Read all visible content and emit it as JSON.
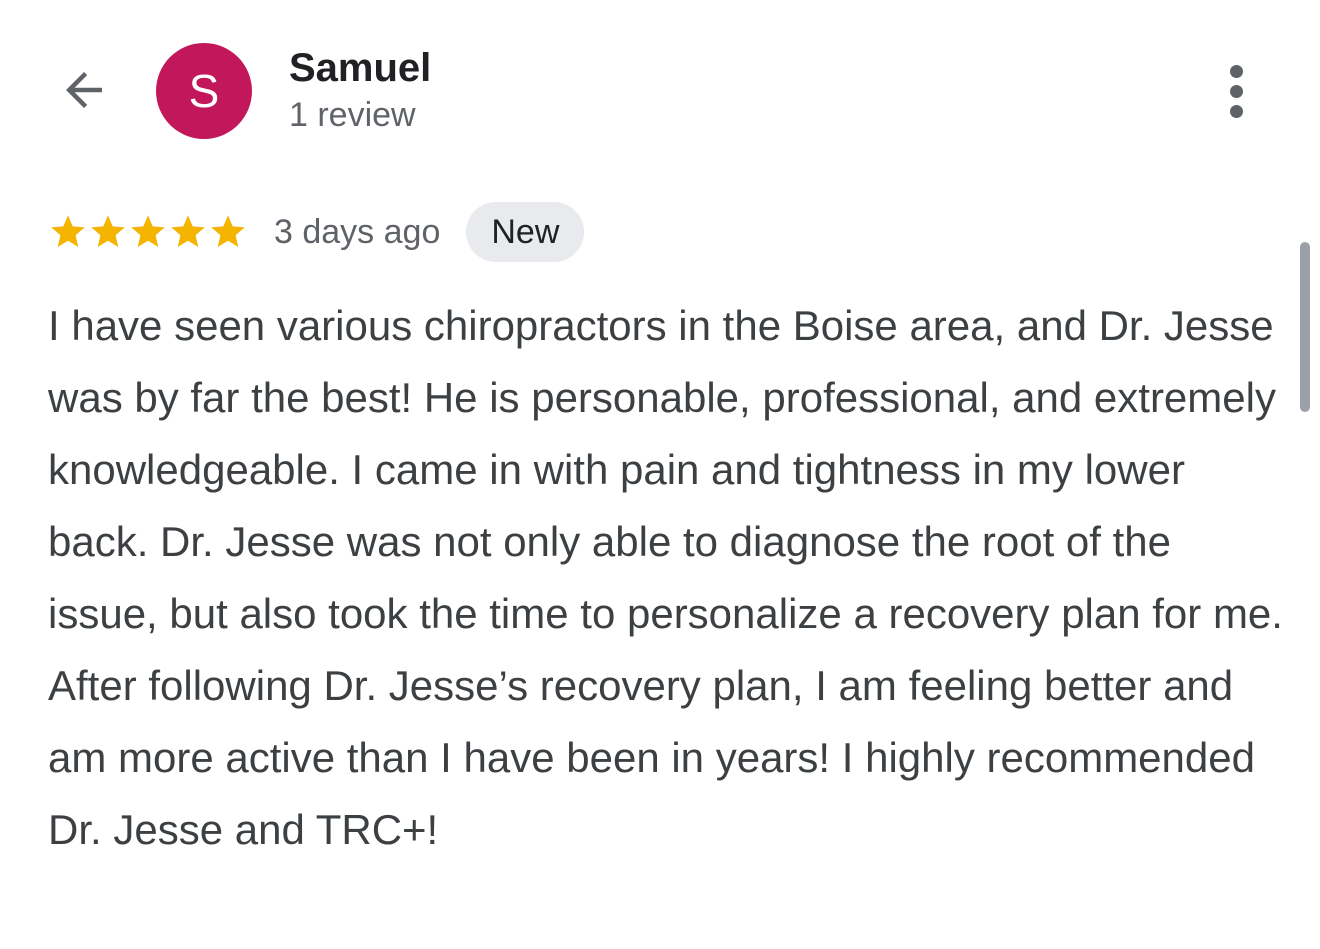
{
  "header": {
    "back_icon": "arrow-left-icon",
    "avatar_letter": "S",
    "avatar_color": "#c2185b",
    "reviewer_name": "Samuel",
    "review_count": "1 review",
    "more_icon": "more-vert-icon"
  },
  "review": {
    "rating": 5,
    "rating_max": 5,
    "star_color": "#f4b400",
    "date": "3 days ago",
    "badge": "New",
    "text": "I have seen various chiropractors in the Boise area, and Dr. Jesse was by far the best! He is personable, professional, and extremely knowledgeable. I came in with pain and tightness in my lower back. Dr. Jesse was not only able to diagnose the root of the issue, but also took the time to personalize a recovery plan for me. After following Dr. Jesse’s recovery plan, I am feeling better and am more active than I have been in years! I highly recommended Dr. Jesse and TRC+!"
  }
}
